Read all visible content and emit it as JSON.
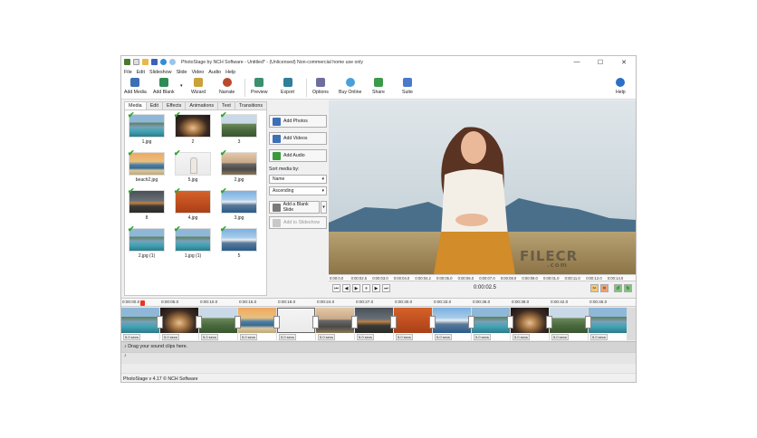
{
  "window": {
    "title": "PhotoStage by NCH Software - Untitled* - (Unlicensed) Non-commercial home use only",
    "minimize": "—",
    "maximize": "☐",
    "close": "✕"
  },
  "menu": [
    "File",
    "Edit",
    "Slideshow",
    "Slide",
    "Video",
    "Audio",
    "Help"
  ],
  "toolbar": {
    "add_media": "Add Media",
    "add_blank": "Add Blank",
    "wizard": "Wizard",
    "narrate": "Narrate",
    "preview": "Preview",
    "export": "Export",
    "options": "Options",
    "buy_online": "Buy Online",
    "share": "Share",
    "suite": "Suite",
    "help": "Help"
  },
  "tabs": [
    "Media",
    "Edit",
    "Effects",
    "Animations",
    "Text",
    "Transitions"
  ],
  "media": [
    {
      "label": "1.jpg",
      "scene": "lake"
    },
    {
      "label": "2",
      "scene": "cave"
    },
    {
      "label": "3",
      "scene": "hills"
    },
    {
      "label": "beach2.jpg",
      "scene": "beach"
    },
    {
      "label": "5.jpg",
      "scene": "person"
    },
    {
      "label": "2.jpg",
      "scene": "road"
    },
    {
      "label": "8",
      "scene": "storm"
    },
    {
      "label": "4.jpg",
      "scene": "orange"
    },
    {
      "label": "3.jpg",
      "scene": "mountain"
    },
    {
      "label": "2.jpg (1)",
      "scene": "lake"
    },
    {
      "label": "1.jpg (1)",
      "scene": "lake"
    },
    {
      "label": "5",
      "scene": "mountain"
    }
  ],
  "side": {
    "add_photos": "Add Photos",
    "add_videos": "Add Videos",
    "add_audio": "Add Audio",
    "sort_label": "Sort media by:",
    "sort_by": "Name",
    "sort_order": "Ascending",
    "add_blank_slide": "Add a Blank Slide",
    "add_to_slideshow": "Add to Slideshow"
  },
  "preview_ruler": [
    "0:00:0.0",
    "0:00:02.5",
    "0:00:03.0",
    "0:00:04.0",
    "0:00:04.2",
    "0:00:05.0",
    "0:00:06.0",
    "0:00:07.0",
    "0:00:08.0",
    "0:00:09.0",
    "0:00:01.0",
    "0:00:11.0",
    "0:00:12.0",
    "0:00:14.0"
  ],
  "preview_time": "0:00:02.5",
  "watermark": "FILECR",
  "watermark_sub": ".com",
  "timeline_ruler": [
    "0:00:00.0",
    "0:00:05.0",
    "0:00:10.0",
    "0:00:15.0",
    "0:00:18.0",
    "0:00:24.0",
    "0:00:27.0",
    "0:00:30.0",
    "0:00:33.0",
    "0:00:36.0",
    "0:00:39.0",
    "0:00:42.0",
    "0:00:45.0"
  ],
  "clip_duration": "5.0 secs",
  "clips": [
    "lake",
    "cave",
    "hills",
    "beach",
    "person",
    "road",
    "storm",
    "orange",
    "mountain",
    "lake",
    "cave",
    "hills",
    "lake"
  ],
  "audio_hint": "Drag your sound clips here.",
  "status": "PhotoStage v 4.17 © NCH Software",
  "colors": {
    "accent": "#2aa52a",
    "playhead": "#e32222"
  }
}
